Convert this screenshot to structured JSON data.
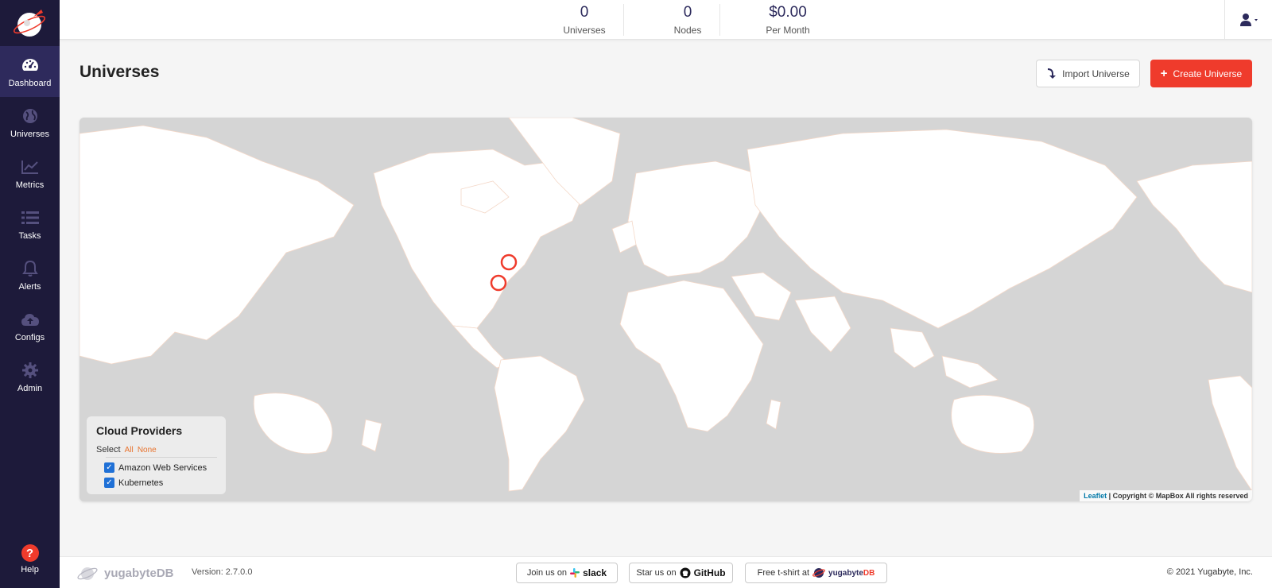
{
  "app": {
    "brand": "yugabyteDB",
    "brand_prefix": "yugabyte",
    "brand_suffix": "DB"
  },
  "topbar": {
    "stats": [
      {
        "value": "0",
        "label": "Universes"
      },
      {
        "value": "0",
        "label": "Nodes"
      },
      {
        "value": "$0.00",
        "label": "Per Month"
      }
    ],
    "user_icon": "user-icon"
  },
  "sidebar": {
    "items": [
      {
        "label": "Dashboard",
        "icon": "dashboard-gauge-icon",
        "active": true
      },
      {
        "label": "Universes",
        "icon": "globe-icon",
        "active": false
      },
      {
        "label": "Metrics",
        "icon": "line-chart-icon",
        "active": false
      },
      {
        "label": "Tasks",
        "icon": "list-icon",
        "active": false
      },
      {
        "label": "Alerts",
        "icon": "bell-icon",
        "active": false
      },
      {
        "label": "Configs",
        "icon": "cloud-upload-icon",
        "active": false
      },
      {
        "label": "Admin",
        "icon": "gear-icon",
        "active": false
      }
    ],
    "help_label": "Help"
  },
  "main": {
    "title": "Universes",
    "import_label": "Import Universe",
    "create_label": "Create Universe"
  },
  "map": {
    "legend": {
      "title": "Cloud Providers",
      "select_label": "Select",
      "all_label": "All",
      "none_label": "None",
      "providers": [
        {
          "label": "Amazon Web Services",
          "checked": true
        },
        {
          "label": "Kubernetes",
          "checked": true
        }
      ]
    },
    "attribution_link": "Leaflet",
    "attribution_text": "| Copyright © MapBox All rights reserved",
    "marker_color": "#ef3b2c"
  },
  "footer": {
    "version": "Version: 2.7.0.0",
    "slack_prefix": "Join us on",
    "slack_name": "slack",
    "github_prefix": "Star us on",
    "github_name": "GitHub",
    "tshirt_prefix": "Free t-shirt at",
    "copyright": "© 2021 Yugabyte, Inc."
  },
  "colors": {
    "sidebar_bg": "#1d1a3a",
    "accent": "#ef3b2c",
    "checkbox": "#1f70d6"
  }
}
